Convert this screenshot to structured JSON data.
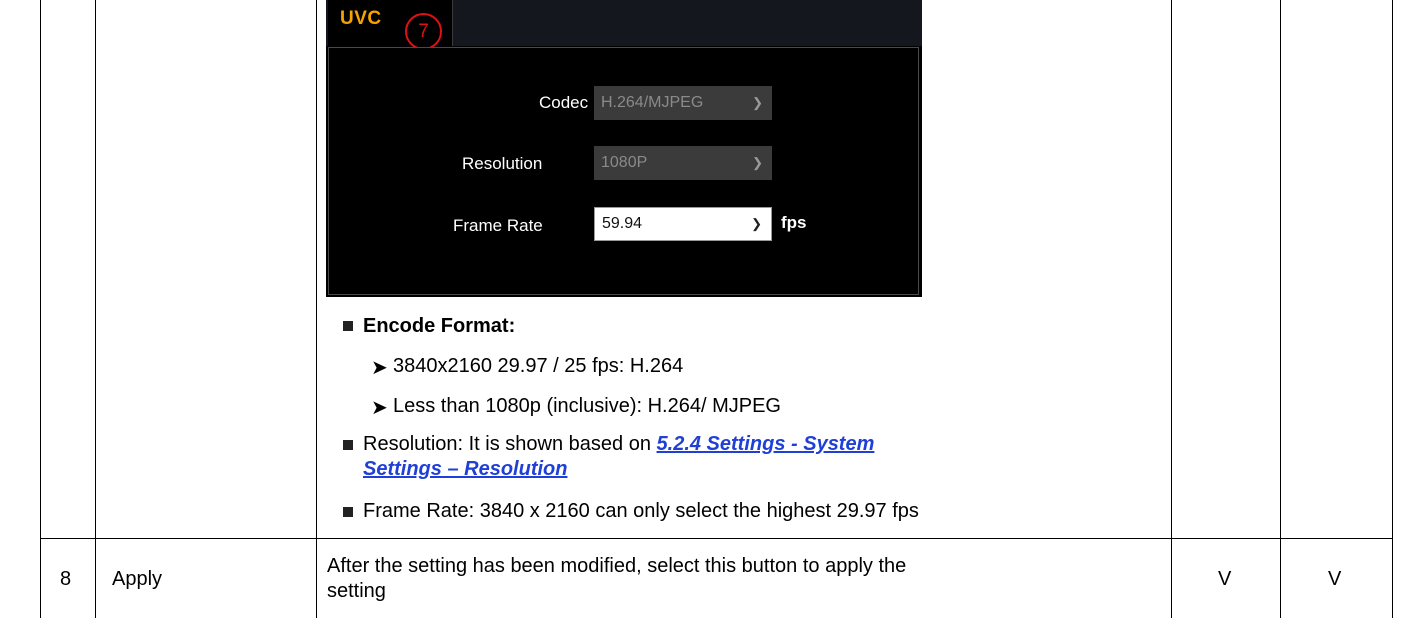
{
  "uvc_panel": {
    "tab_label": "UVC",
    "callout_number": "7",
    "fields": [
      {
        "label": "Codec",
        "value": "H.264/MJPEG",
        "enabled": false
      },
      {
        "label": "Resolution",
        "value": "1080P",
        "enabled": false
      },
      {
        "label": "Frame Rate",
        "value": "59.94",
        "enabled": true,
        "unit": "fps"
      }
    ]
  },
  "notes": {
    "encode_format_heading": "Encode Format:",
    "encode_items": [
      "3840x2160 29.97 / 25 fps: H.264",
      "Less than 1080p (inclusive): H.264/ MJPEG"
    ],
    "resolution_prefix": "Resolution: It is shown based on ",
    "resolution_link_line1": "5.2.4 Settings - System ",
    "resolution_link_line2": "Settings – Resolution",
    "frame_rate_note": "Frame Rate: 3840 x 2160 can only select the highest 29.97 fps"
  },
  "row8": {
    "number": "8",
    "name": "Apply",
    "description_line1": "After the setting has been modified, select this button to apply the",
    "description_line2": "setting",
    "col4": "V",
    "col5": "V"
  },
  "colors": {
    "tab_text": "#f5a300",
    "callout": "#e01010",
    "link": "#1f3fd6"
  }
}
